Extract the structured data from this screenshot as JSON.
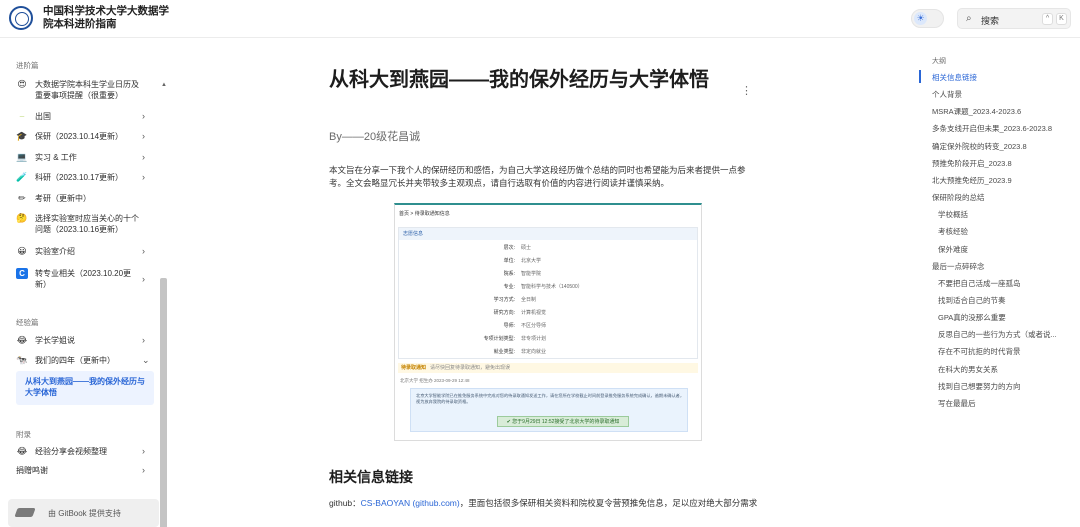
{
  "header": {
    "site_title_line1": "中国科学技术大学大数据学",
    "site_title_line2": "院本科进阶指南",
    "theme_icon": "sun-icon",
    "search_label": "搜索",
    "search_key1": "^",
    "search_key2": "K"
  },
  "sidebar": {
    "section1": "进阶篇",
    "items": [
      {
        "icon": "😍",
        "label": "大数据学院本科生学业日历及重要事项提醒（很重要）",
        "chevron": ""
      },
      {
        "icon": "⎯",
        "label": "出国",
        "chevron": "›"
      },
      {
        "icon": "🎓",
        "label": "保研（2023.10.14更新）",
        "chevron": "›"
      },
      {
        "icon": "💻",
        "label": "实习 & 工作",
        "chevron": "›"
      },
      {
        "icon": "🧪",
        "label": "科研（2023.10.17更新）",
        "chevron": "›"
      },
      {
        "icon": "✏",
        "label": "考研（更新中）",
        "chevron": ""
      },
      {
        "icon": "🤔",
        "label": "选择实验室时应当关心的十个问题（2023.10.16更新）",
        "chevron": ""
      },
      {
        "icon": "😀",
        "label": "实验室介绍",
        "chevron": "›"
      },
      {
        "icon": "C",
        "label": "转专业相关（2023.10.20更新）",
        "chevron": "›"
      }
    ],
    "section2": "经验篇",
    "items2": [
      {
        "icon": "😂",
        "label": "学长学姐说",
        "chevron": "›"
      },
      {
        "icon": "🐄",
        "label": "我们的四年（更新中）",
        "chevron": "⌄"
      }
    ],
    "active_item": "从科大到燕园——我的保外经历与大学体悟",
    "section3": "附录",
    "items3": [
      {
        "icon": "😂",
        "label": "经验分享会视频整理",
        "chevron": "›"
      },
      {
        "icon": "",
        "label": "捐赠鸣谢",
        "chevron": "›"
      }
    ],
    "gitbook_label": "由 GitBook 提供支持"
  },
  "main": {
    "title": "从科大到燕园——我的保外经历与大学体悟",
    "byline": "By——20级花昌诚",
    "intro": "本文旨在分享一下我个人的保研经历和感悟，为自己大学这段经历做个总结的同时也希望能为后来者提供一点参考。全文会略显冗长并夹带较多主观观点，请自行选取有价值的内容进行阅读并谨慎采纳。",
    "screenshot": {
      "breadcrumb": "首页 > 待录取通知信息",
      "panel_title": "志愿信息",
      "rows": [
        {
          "k": "层次:",
          "v": "硕士"
        },
        {
          "k": "单位:",
          "v": "北京大学"
        },
        {
          "k": "院系:",
          "v": "智能学院"
        },
        {
          "k": "专业:",
          "v": "智能科学与技术（140500）"
        },
        {
          "k": "学习方式:",
          "v": "全日制"
        },
        {
          "k": "研究方向:",
          "v": "计算机视觉"
        },
        {
          "k": "导师:",
          "v": "不区分导师"
        },
        {
          "k": "专项计划类型:",
          "v": "非专项计划"
        },
        {
          "k": "就业类型:",
          "v": "非定向就业"
        }
      ],
      "notice_label": "待录取通知",
      "notice_hint": "请尽快回复待录取通知，避免出现误",
      "notice_date": "北京大学 招生办 2023-09-29 12:48",
      "notice_text": "北京大学智能学院已在推免服务系统中完成对您的待录取通知发送工作，请在您所在学校截止时间前登录推免服务系统完成确认，逾期未确认者，视为放弃我院的待录取资格。",
      "notice_button": "您于9月29日 12:52接受了北京大学的待录取通知"
    },
    "section_heading": "相关信息链接",
    "github_prefix": "github：",
    "github_link": "CS-BAOYAN (github.com)",
    "github_suffix": "，里面包括很多保研相关资料和院校夏令营预推免信息，足以应对绝大部分需求"
  },
  "toc": {
    "title": "大纲",
    "items": [
      {
        "label": "相关信息链接",
        "level": 1,
        "active": true
      },
      {
        "label": "个人背景",
        "level": 1,
        "active": false
      },
      {
        "label": "MSRA课题_2023.4-2023.6",
        "level": 1,
        "active": false
      },
      {
        "label": "多条支线开启但未果_2023.6-2023.8",
        "level": 1,
        "active": false
      },
      {
        "label": "确定保外院校的转变_2023.8",
        "level": 1,
        "active": false
      },
      {
        "label": "预推免阶段开启_2023.8",
        "level": 1,
        "active": false
      },
      {
        "label": "北大预推免经历_2023.9",
        "level": 1,
        "active": false
      },
      {
        "label": "保研阶段的总结",
        "level": 1,
        "active": false
      },
      {
        "label": "学校概括",
        "level": 2,
        "active": false
      },
      {
        "label": "考核经验",
        "level": 2,
        "active": false
      },
      {
        "label": "保外难度",
        "level": 2,
        "active": false
      },
      {
        "label": "最后一点碎碎念",
        "level": 1,
        "active": false
      },
      {
        "label": "不要把自己活成一座孤岛",
        "level": 2,
        "active": false
      },
      {
        "label": "找到适合自己的节奏",
        "level": 2,
        "active": false
      },
      {
        "label": "GPA真的没那么重要",
        "level": 2,
        "active": false
      },
      {
        "label": "反思自己的一些行为方式（或者说...",
        "level": 2,
        "active": false
      },
      {
        "label": "存在不可抗拒的时代背景",
        "level": 2,
        "active": false
      },
      {
        "label": "在科大的男女关系",
        "level": 2,
        "active": false
      },
      {
        "label": "找到自己想要努力的方向",
        "level": 2,
        "active": false
      },
      {
        "label": "写在最最后",
        "level": 2,
        "active": false
      }
    ]
  }
}
